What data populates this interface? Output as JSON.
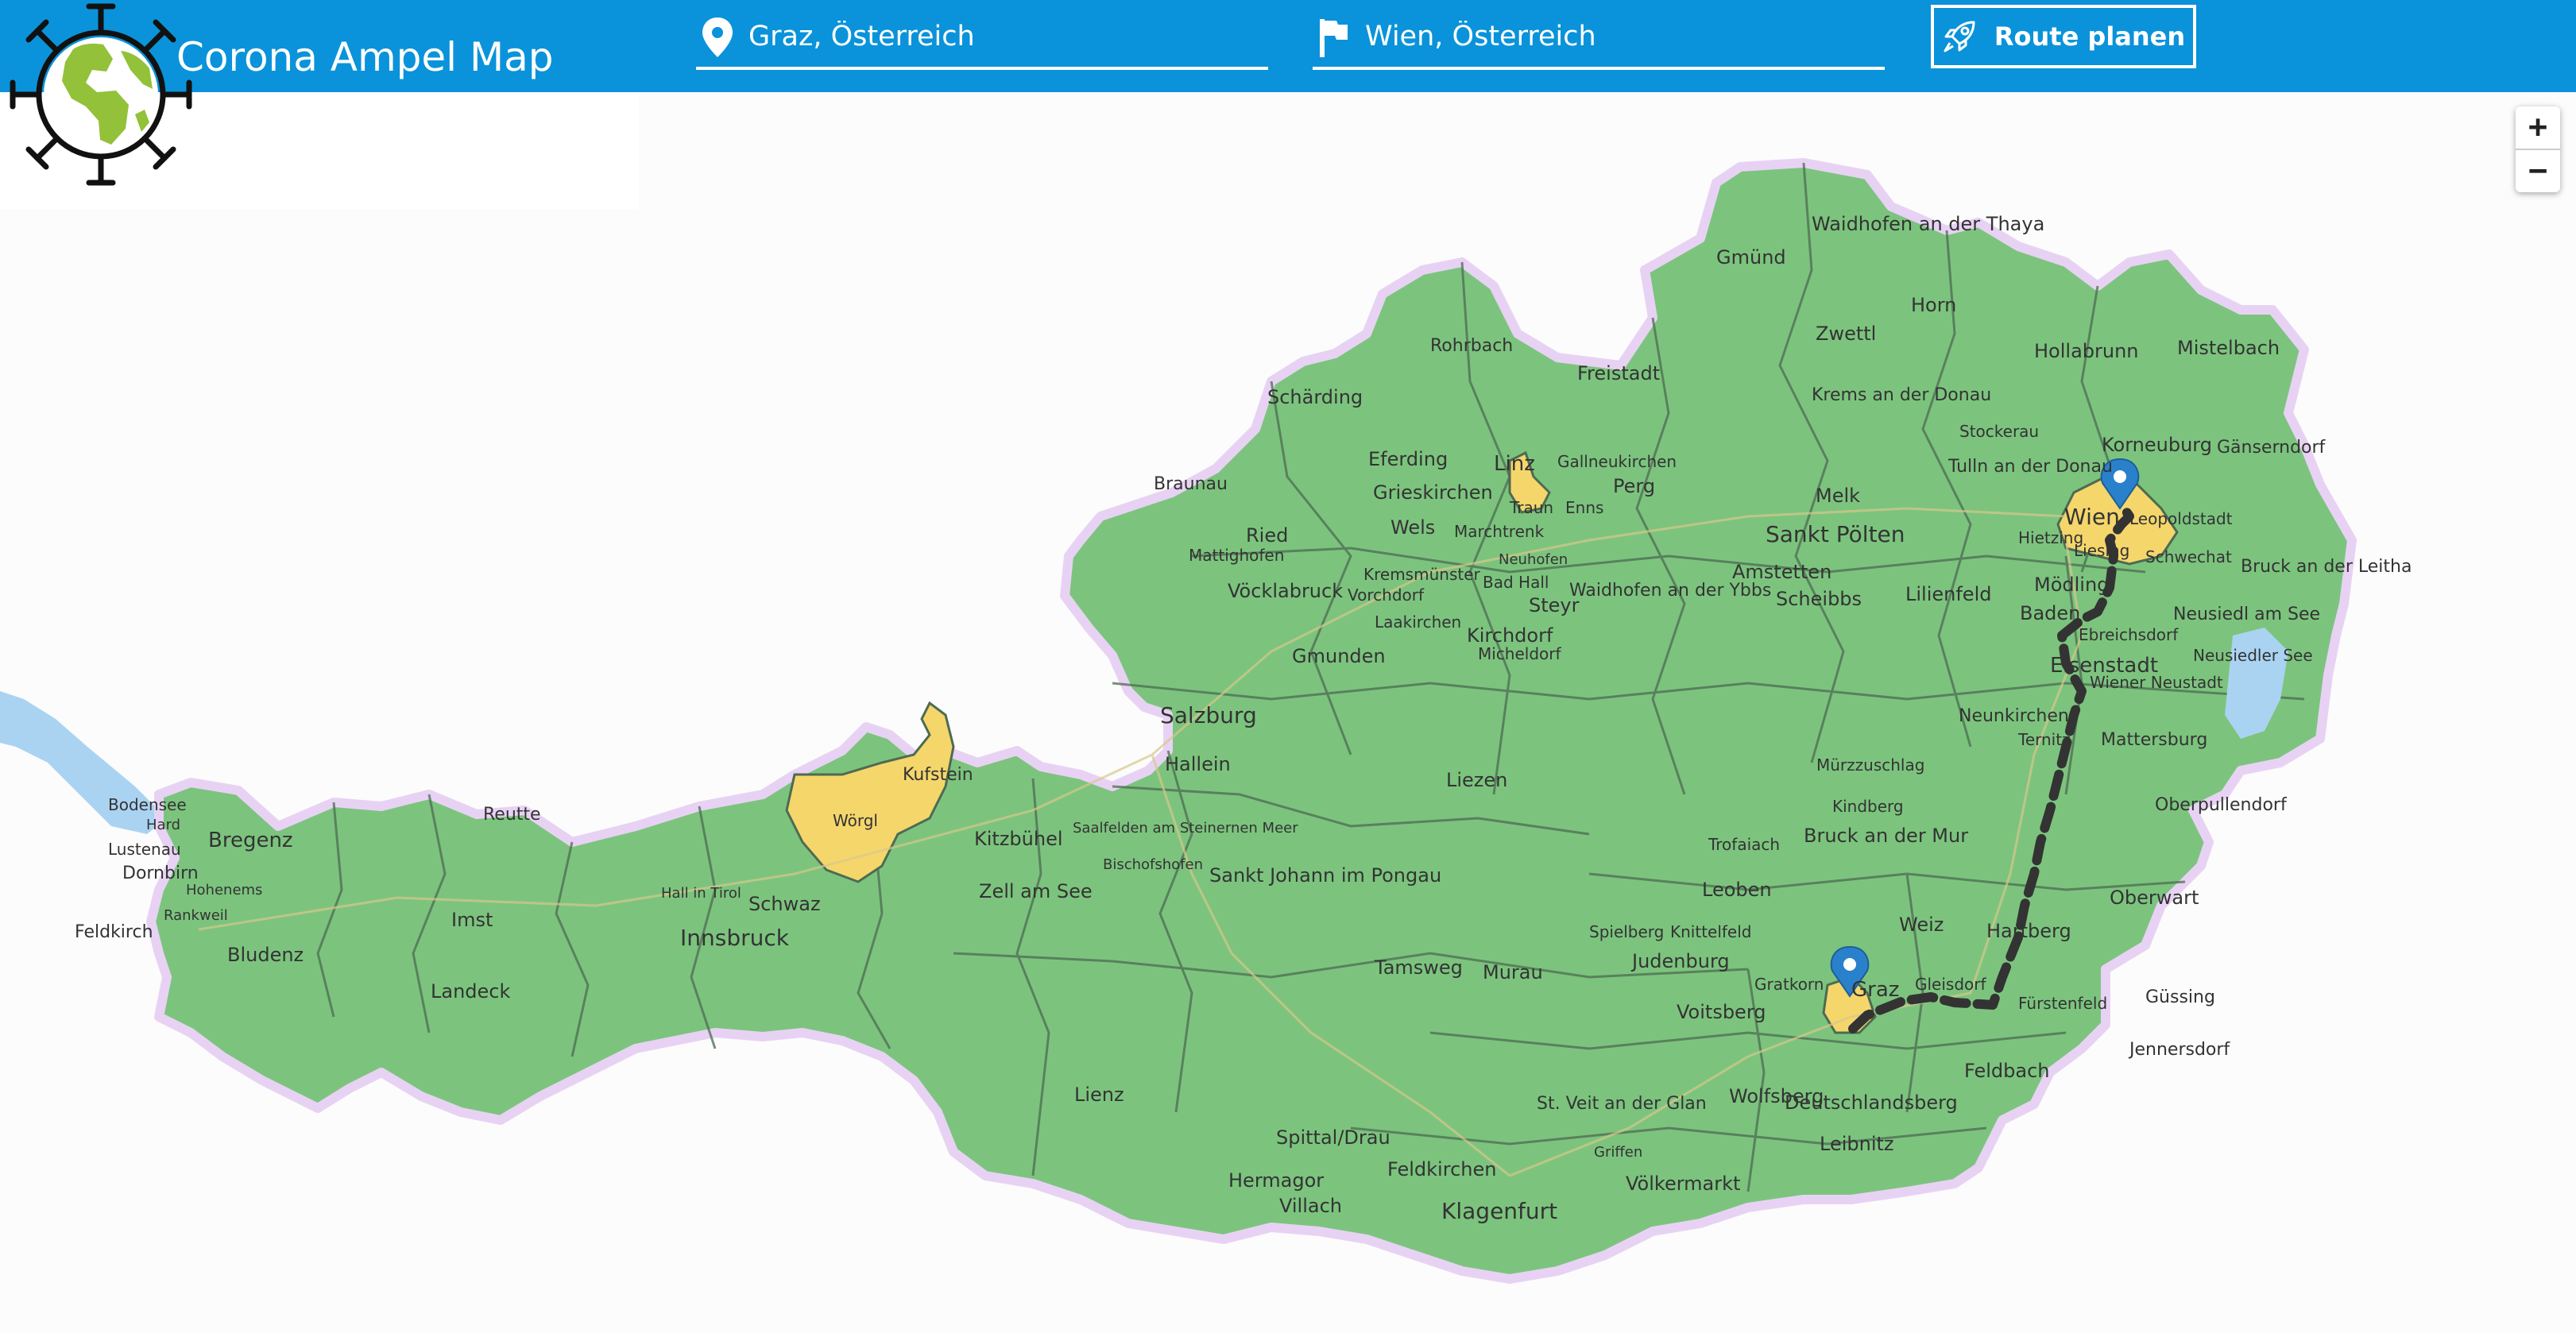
{
  "app": {
    "title": "Corona Ampel Map"
  },
  "search": {
    "origin_value": "Graz, Österreich",
    "destination_value": "Wien, Österreich",
    "route_button_label": "Route planen"
  },
  "icons": {
    "logo": "virus-globe-icon",
    "origin": "location-pin-icon",
    "destination": "flag-icon",
    "route": "rocket-icon"
  },
  "zoom": {
    "in_label": "+",
    "out_label": "−"
  },
  "colors": {
    "header": "#0a93da",
    "risk_low": "#7bc47c",
    "risk_medium": "#f5d66b",
    "route": "#333333",
    "marker": "#2a81cb"
  },
  "map": {
    "regions_labels": [
      "Waidhofen an der Thaya",
      "Gmünd",
      "Horn",
      "Zwettl",
      "Hollabrunn",
      "Mistelbach",
      "Rohrbach",
      "Freistadt",
      "Schärding",
      "Krems an der Donau",
      "Korneuburg",
      "Gänserndorf",
      "Braunau",
      "Eferding",
      "Linz",
      "Perg",
      "Tulln an der Donau",
      "Wien",
      "Grieskirchen",
      "Wels",
      "Melk",
      "Sankt Pölten",
      "Ried",
      "Vöcklabruck",
      "Steyr",
      "Waidhofen an der Ybbs",
      "Amstetten",
      "Lilienfeld",
      "Mödling",
      "Bruck an der Leitha",
      "Baden",
      "Kirchdorf",
      "Gmunden",
      "Scheibbs",
      "Neusiedl am See",
      "Eisenstadt",
      "Salzburg",
      "Neunkirchen",
      "Mattersburg",
      "Bregenz",
      "Reutte",
      "Kufstein",
      "Hallein",
      "Liezen",
      "Kitzbühel",
      "Schwaz",
      "Wörgl",
      "Dornbirn",
      "Lustenau",
      "Feldkirch",
      "Bludenz",
      "Imst",
      "Innsbruck",
      "Landeck",
      "Zell am See",
      "Sankt Johann im Pongau",
      "Bruck an der Mur",
      "Leoben",
      "Oberpullendorf",
      "Oberwart",
      "Weiz",
      "Hartberg",
      "Tamsweg",
      "Murau",
      "Judenburg",
      "Graz",
      "Güssing",
      "Voitsberg",
      "Jennersdorf",
      "Feldbach",
      "Lienz",
      "Wolfsberg",
      "Deutschlandsberg",
      "Leibnitz",
      "St. Veit an der Glan",
      "Spittal/Drau",
      "Feldkirchen",
      "Hermagor",
      "Villach",
      "Klagenfurt",
      "Völkermarkt",
      "Bodensee",
      "Neusiedler See",
      "Mürzzuschlag",
      "Kindberg",
      "Trofaiach",
      "Knittelfeld",
      "Spielberg",
      "Gratkorn",
      "Gleisdorf",
      "Fürstenfeld",
      "Mattighofen",
      "Marchtrenk",
      "Traun",
      "Enns",
      "Kremsmünster",
      "Bad Hall",
      "Vorchdorf",
      "Laakirchen",
      "Micheldorf",
      "Stockerau",
      "Gallneukirchen",
      "Leopoldstadt",
      "Hietzing",
      "Liesing",
      "Schwechat",
      "Ebreichsdorf",
      "Wiener Neustadt",
      "Ternitz",
      "Saalfelden am Steinernen Meer",
      "Bischofshofen",
      "Hall in Tirol",
      "Hard",
      "Hohenems",
      "Rankweil",
      "Griffen",
      "Neuhofen"
    ],
    "route": {
      "from": "Graz",
      "to": "Wien"
    }
  }
}
